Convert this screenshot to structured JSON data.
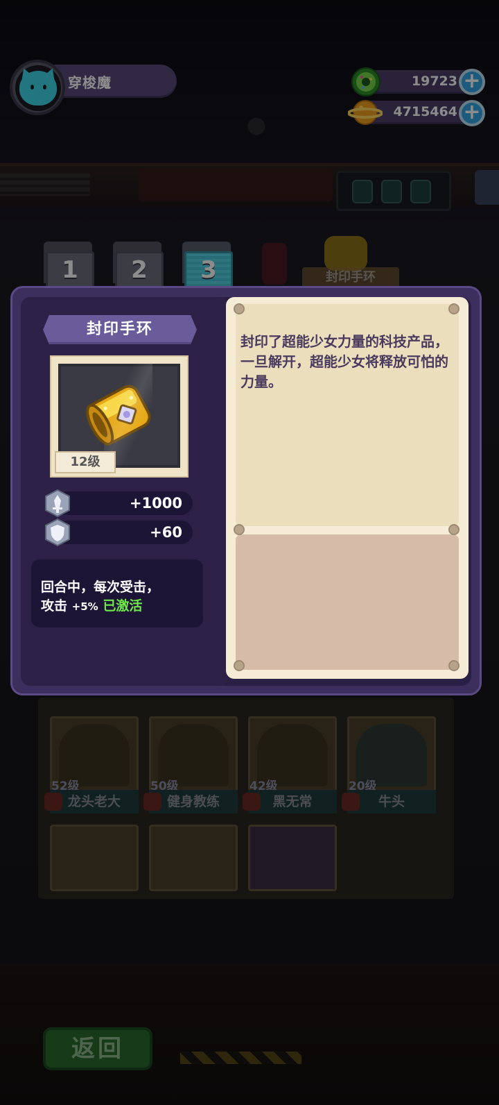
{
  "player": {
    "name": "穿梭魔",
    "avatar": "cyan-cat-avatar-icon"
  },
  "currencies": [
    {
      "icon": "green-donut-coin-icon",
      "value": "19723"
    },
    {
      "icon": "orange-planet-coin-icon",
      "value": "4715464"
    }
  ],
  "tabs": [
    {
      "label": "1",
      "active": false
    },
    {
      "label": "2",
      "active": false
    },
    {
      "label": "3",
      "active": true
    }
  ],
  "background_label": "封印手环",
  "item": {
    "name": "封印手环",
    "level": "12级",
    "icon": "gold-bracelet-icon",
    "stats": [
      {
        "icon": "sword-stat-icon",
        "value": "+1000"
      },
      {
        "icon": "shield-stat-icon",
        "value": "+60"
      }
    ],
    "effect": {
      "line1": "回合中，每次受击，",
      "line2_prefix": "攻击",
      "line2_pct": "+5%",
      "status": "已激活"
    },
    "description": "封印了超能少女力量的科技产品，一旦解开，超能少女将释放可怕的力量。"
  },
  "roster": [
    {
      "level": "52级",
      "name": "龙头老大"
    },
    {
      "level": "50级",
      "name": "健身教练"
    },
    {
      "level": "42级",
      "name": "黑无常"
    },
    {
      "level": "20级",
      "name": "牛头"
    }
  ],
  "back_button": "返回",
  "colors": {
    "accent_cyan": "#3ed8e8",
    "panel_purple": "#3c2e5d",
    "active_green": "#6fe84a",
    "plus_blue": "#34a7e6"
  }
}
